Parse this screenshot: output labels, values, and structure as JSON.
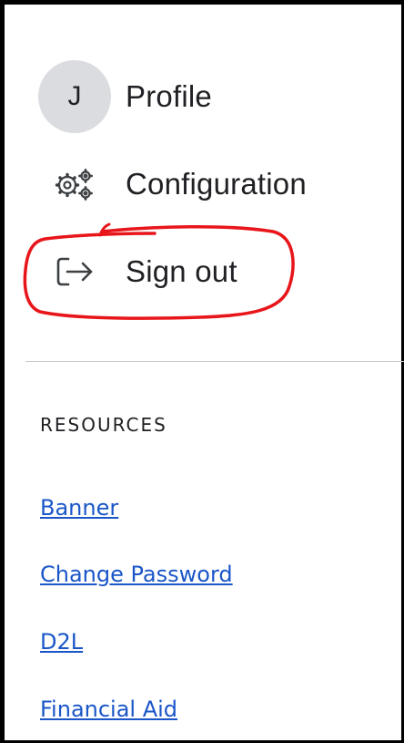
{
  "menu": {
    "profile": {
      "avatar_initial": "J",
      "label": "Profile",
      "icon": "avatar-circle"
    },
    "configuration": {
      "label": "Configuration",
      "icon": "gears-icon"
    },
    "sign_out": {
      "label": "Sign out",
      "icon": "sign-out-arrow-icon"
    }
  },
  "annotation": {
    "color": "#e8151b",
    "shape": "hand-drawn-ellipse"
  },
  "resources": {
    "title": "RESOURCES",
    "links": [
      "Banner",
      "Change Password",
      "D2L",
      "Financial Aid"
    ]
  },
  "colors": {
    "link": "#1a56c8",
    "avatar_bg": "#dadce0",
    "text": "#202124",
    "divider": "#c8c8c8"
  }
}
